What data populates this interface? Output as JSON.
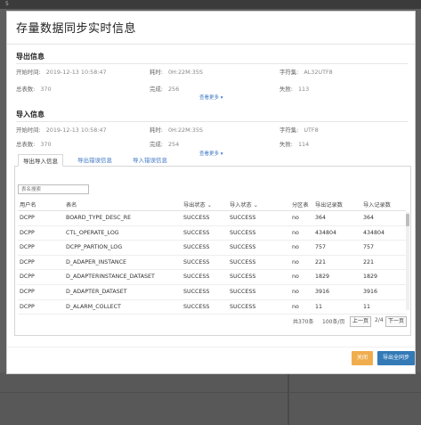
{
  "backdrop": {
    "corner_text": "5"
  },
  "modal": {
    "title": "存量数据同步实时信息"
  },
  "export_info": {
    "section_title": "导出信息",
    "start_time_label": "开始时间:",
    "start_time": "2019-12-13 10:58:47",
    "elapsed_label": "耗时:",
    "elapsed": "0H:22M:35S",
    "charset_label": "字符集:",
    "charset": "AL32UTF8",
    "total_label": "总表数:",
    "total": "370",
    "done_label": "完成:",
    "done": "256",
    "failed_label": "失败:",
    "failed": "113",
    "more_link": "查看更多 ▾"
  },
  "import_info": {
    "section_title": "导入信息",
    "start_time_label": "开始时间:",
    "start_time": "2019-12-13 10:58:47",
    "elapsed_label": "耗时:",
    "elapsed": "0H:22M:35S",
    "charset_label": "字符集:",
    "charset": "UTF8",
    "total_label": "总表数:",
    "total": "370",
    "done_label": "完成:",
    "done": "254",
    "failed_label": "失败:",
    "failed": "114",
    "more_link": "查看更多 ▾"
  },
  "tabs": [
    "导出导入信息",
    "导出错误信息",
    "导入错误信息"
  ],
  "search": {
    "placeholder": "表名搜索"
  },
  "table": {
    "headers": [
      "用户名",
      "表名",
      "导出状态 ⌄",
      "导入状态 ⌄",
      "分区表",
      "导出记录数",
      "导入记录数"
    ],
    "rows": [
      [
        "DCPP",
        "BOARD_TYPE_DESC_RE",
        "SUCCESS",
        "SUCCESS",
        "no",
        "364",
        "364"
      ],
      [
        "DCPP",
        "CTL_OPERATE_LOG",
        "SUCCESS",
        "SUCCESS",
        "no",
        "434804",
        "434804"
      ],
      [
        "DCPP",
        "DCPP_PARTION_LOG",
        "SUCCESS",
        "SUCCESS",
        "no",
        "757",
        "757"
      ],
      [
        "DCPP",
        "D_ADAPER_INSTANCE",
        "SUCCESS",
        "SUCCESS",
        "no",
        "221",
        "221"
      ],
      [
        "DCPP",
        "D_ADAPTERINSTANCE_DATASET",
        "SUCCESS",
        "SUCCESS",
        "no",
        "1829",
        "1829"
      ],
      [
        "DCPP",
        "D_ADAPTER_DATASET",
        "SUCCESS",
        "SUCCESS",
        "no",
        "3916",
        "3916"
      ],
      [
        "DCPP",
        "D_ALARM_COLLECT",
        "SUCCESS",
        "SUCCESS",
        "no",
        "11",
        "11"
      ]
    ]
  },
  "pager": {
    "summary": "共370条",
    "page_size": "100条/页",
    "prev": "上一页",
    "page_indicator": "2/4",
    "next": "下一页"
  },
  "footer": {
    "cancel_label": "关闭",
    "export_label": "导出全同步"
  }
}
